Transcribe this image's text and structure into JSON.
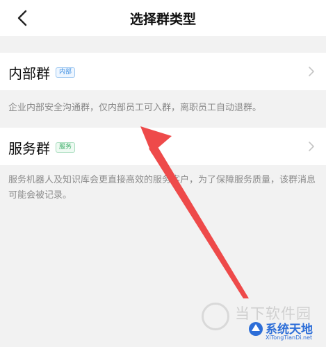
{
  "header": {
    "title": "选择群类型",
    "back_icon": "chevron-left-icon"
  },
  "options": [
    {
      "title": "内部群",
      "badge": "内部",
      "badge_color": "#3b8de0",
      "description": "企业内部安全沟通群，仅内部员工可入群，离职员工自动退群。"
    },
    {
      "title": "服务群",
      "badge": "服务",
      "badge_color": "#3fae6a",
      "description": "服务机器人及知识库会更直接高效的服务客户，为了保障服务质量，该群消息可能会被记录。"
    }
  ],
  "colors": {
    "annotation_arrow": "#ee4a4a",
    "background": "#f2f2f2"
  },
  "watermark": {
    "text_1": "当下软件园",
    "text_2": "系统天地",
    "text_2_sub": "XiTongTianDi.net"
  }
}
